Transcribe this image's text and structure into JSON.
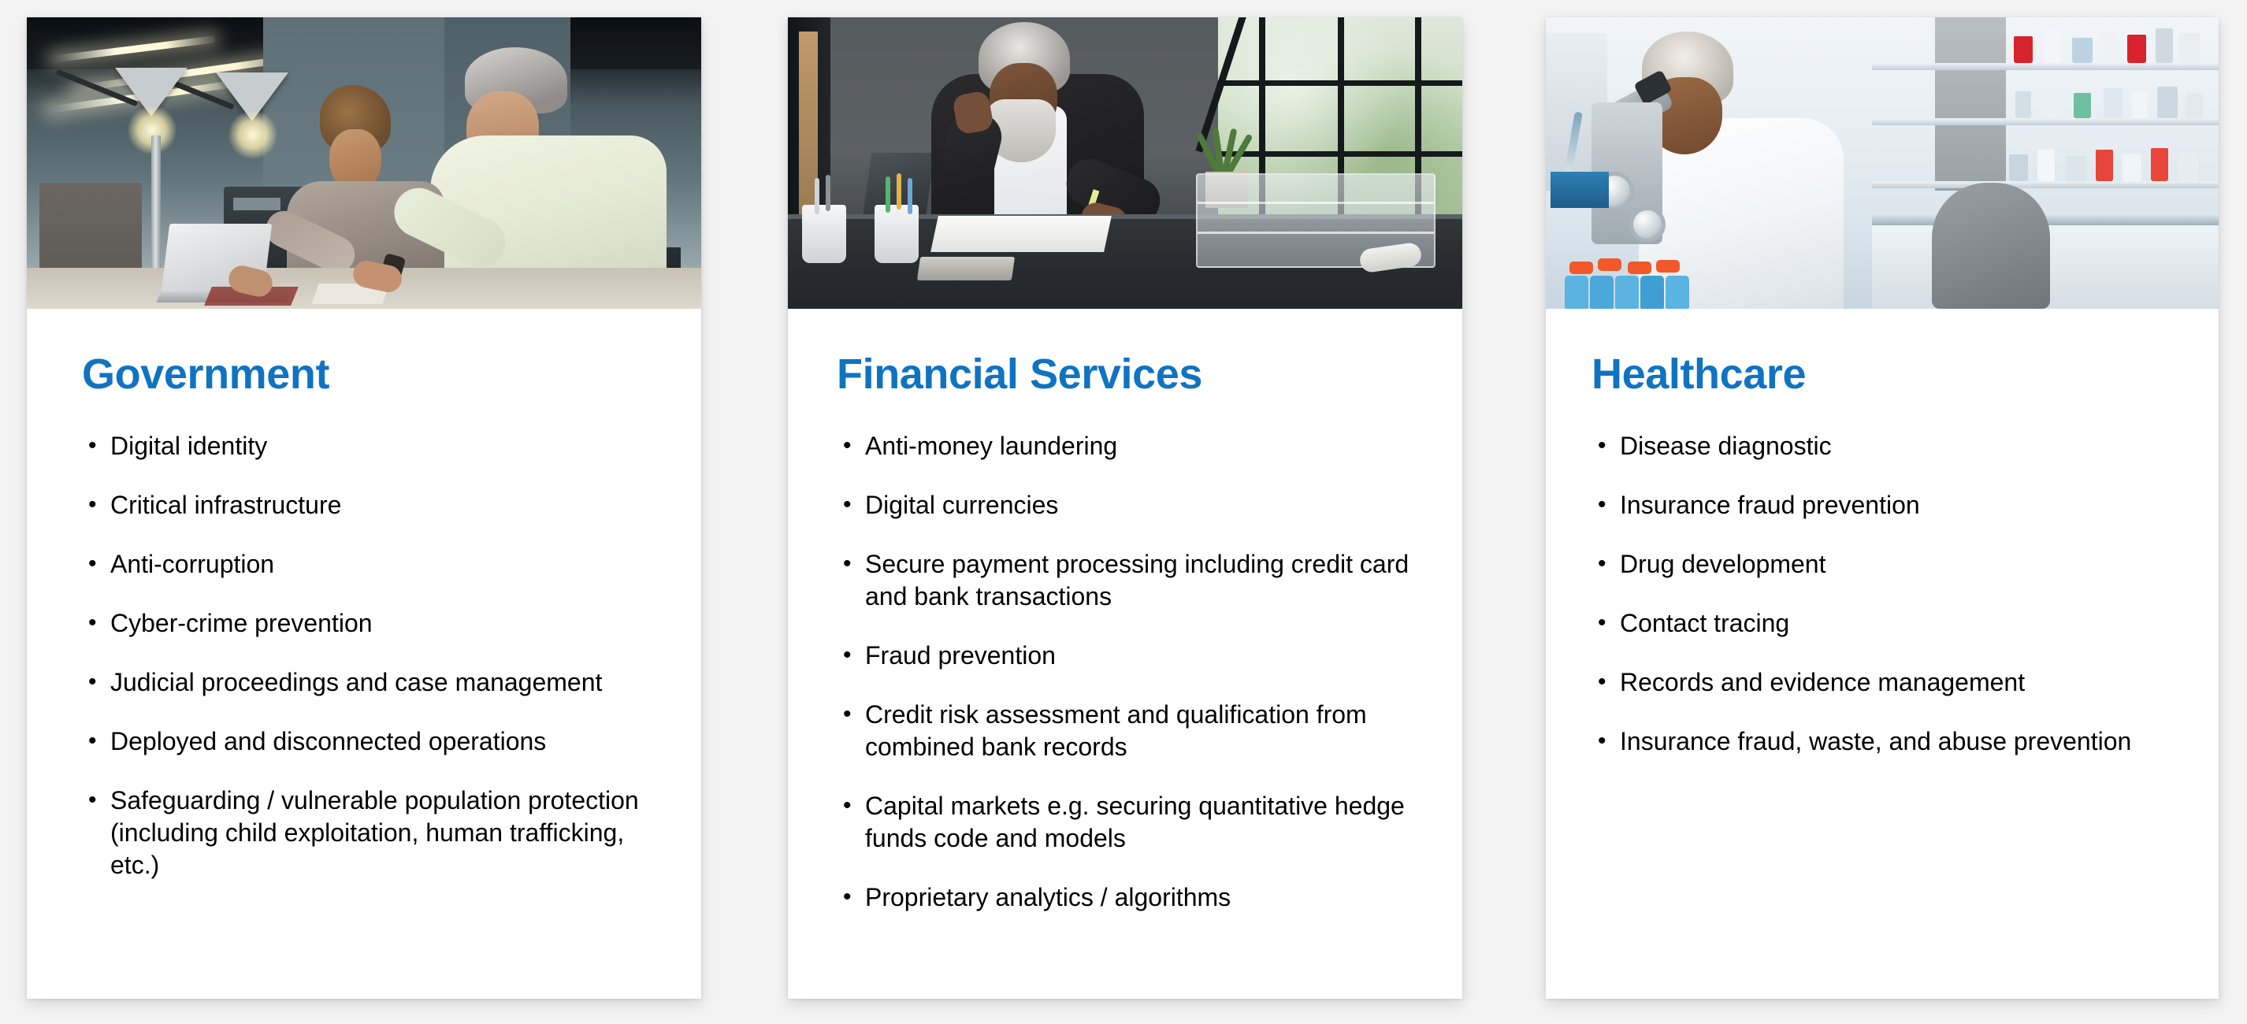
{
  "slide": {
    "background_color": "#f3f3f3",
    "accent_color": "#1073c2",
    "text_color": "#000000"
  },
  "cards": [
    {
      "id": "government",
      "title": "Government",
      "image": {
        "name": "office-collaboration-photo",
        "alt": "Two colleagues reviewing work on a laptop at a desk with task lamps in an office"
      },
      "bullets": [
        "Digital identity",
        "Critical infrastructure",
        "Anti-corruption",
        "Cyber-crime prevention",
        "Judicial proceedings and case management",
        "Deployed and disconnected operations",
        "Safeguarding / vulnerable population protection (including child exploitation, human trafficking, etc.)"
      ]
    },
    {
      "id": "financial-services",
      "title": "Financial Services",
      "image": {
        "name": "businessman-at-desk-photo",
        "alt": "Bearded businessman in a suit working at a dark desk beside large windows"
      },
      "bullets": [
        "Anti-money laundering",
        "Digital currencies",
        "Secure payment processing including credit card and bank transactions",
        "Fraud prevention",
        "Credit risk assessment and qualification from combined bank records",
        "Capital markets e.g. securing quantitative hedge funds code and models",
        "Proprietary analytics / algorithms"
      ]
    },
    {
      "id": "healthcare",
      "title": "Healthcare",
      "image": {
        "name": "lab-scientist-microscope-photo",
        "alt": "Scientist in a white coat looking through a microscope in a laboratory"
      },
      "bullets": [
        "Disease diagnostic",
        "Insurance fraud prevention",
        "Drug development",
        "Contact tracing",
        "Records and evidence management",
        "Insurance fraud, waste, and abuse prevention"
      ]
    }
  ]
}
